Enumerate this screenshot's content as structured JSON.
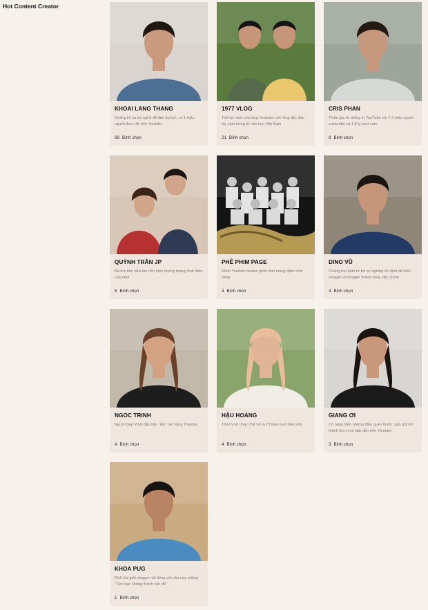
{
  "page": {
    "title": "Hot Content Creator"
  },
  "vote_label": "Bình chọn",
  "creators": [
    {
      "name": "KHOAI LANG THANG",
      "description": "Chàng kỹ sư bỏ nghề để làm du lịch, có 1 triệu người theo dõi trên Youtube",
      "votes": "89",
      "photo": "man-denim-jacket-photo",
      "colors": {
        "bg": "#d9d4cf",
        "accent": "#4d6f94",
        "skin": "#c99a7e",
        "hair": "#1e1712"
      }
    },
    {
      "name": "1977 VLOG",
      "description": "Thế lực mới của làng Youtuber với Vlog độc đáo lấy cảm hứng từ văn học Việt Nam",
      "votes": "21",
      "photo": "two-men-forest-photo",
      "colors": {
        "bg": "#5b7a3d",
        "accent": "#566b4c",
        "skin": "#c79577",
        "hair": "#141414"
      }
    },
    {
      "name": "CRIS PHAN",
      "description": "Thiếu gia 9x thống trị YouTube với 7,4 triệu người subscribe và 1,8 tỷ lượt xem",
      "votes": "8",
      "photo": "man-posing-photo",
      "colors": {
        "bg": "#9ea59a",
        "accent": "#d7d9d5",
        "skin": "#c6987c",
        "hair": "#231a14"
      }
    },
    {
      "name": "QUỲNH TRẦN JP",
      "description": "Bà mẹ bỉm sữa tạo nên hiện tượng mạng đình đám của năm",
      "votes": "6",
      "photo": "mother-and-child-photo",
      "colors": {
        "bg": "#d8c7b6",
        "accent": "#b63232",
        "skin": "#d1a589",
        "hair": "#3a2418"
      }
    },
    {
      "name": "PHÊ PHIM PAGE",
      "description": "Kênh Youtube review phim ảnh mang đậm chất riêng",
      "votes": "4",
      "photo": "group-film-reel-photo",
      "colors": {
        "bg": "#141414",
        "accent": "#b49a52",
        "skin": "#e9e9e9",
        "hair": "#2b2b2b"
      }
    },
    {
      "name": "DINO VŨ",
      "description": "Chàng trai dám từ bỏ sự nghiệp ổn định để biến vlogger và blogger thành công việc chính",
      "votes": "4",
      "photo": "man-bomber-jacket-photo",
      "colors": {
        "bg": "#8f8677",
        "accent": "#243a66",
        "skin": "#c5967a",
        "hair": "#1b1511"
      }
    },
    {
      "name": "NGOC TRINH",
      "description": "Người đẹp V-biz đầu tiên \"ẵm\" nút vàng Youtube",
      "votes": "4",
      "photo": "woman-street-photo",
      "colors": {
        "bg": "#c2b8aa",
        "accent": "#1d1d1d",
        "skin": "#d2a282",
        "hair": "#6b4128"
      }
    },
    {
      "name": "HẬU HOÀNG",
      "description": "Thánh nữ nhạc chế với 4,73 triệu lượt theo dõi",
      "votes": "4",
      "photo": "woman-plants-photo",
      "colors": {
        "bg": "#8aa56b",
        "accent": "#f1ede7",
        "skin": "#e0b495",
        "hair": "#e9bd9a"
      }
    },
    {
      "name": "GIANG ƠI",
      "description": "Cô nàng biến những điều quen thuộc, gần gũi trở thành thú vị và hấp dẫn trên Youtube",
      "votes": "3",
      "photo": "woman-black-blazer-photo",
      "colors": {
        "bg": "#d8d6d3",
        "accent": "#1a1a1a",
        "skin": "#c9977a",
        "hair": "#1a1411"
      }
    },
    {
      "name": "KHOA PUG",
      "description": "Rich kid giới vlogger nổi tiếng với câu cửa miệng \"Tiền bạc không thành vấn đề\"",
      "votes": "1",
      "photo": "man-desert-photo",
      "colors": {
        "bg": "#c9ab82",
        "accent": "#4a8cc0",
        "skin": "#b98463",
        "hair": "#171310"
      }
    }
  ]
}
